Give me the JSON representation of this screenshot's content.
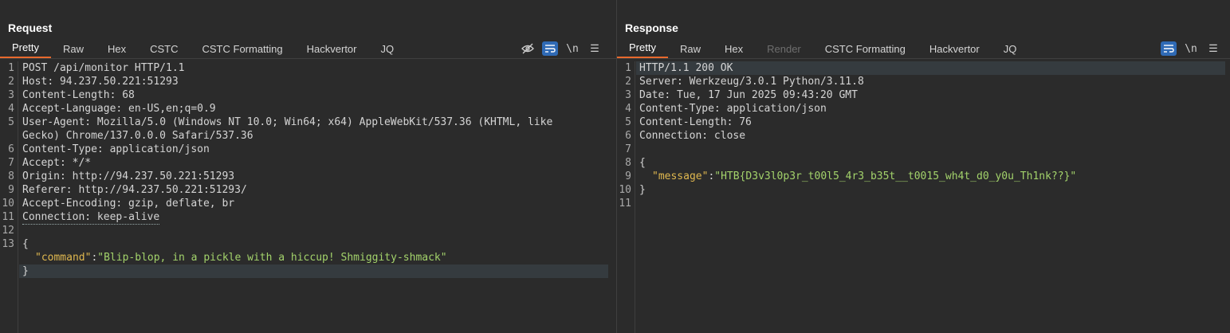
{
  "request": {
    "title": "Request",
    "tabs": [
      "Pretty",
      "Raw",
      "Hex",
      "CSTC",
      "CSTC Formatting",
      "Hackvertor",
      "JQ"
    ],
    "tools": {
      "hide": "⊘",
      "wrap": "≡",
      "newline": "\\n",
      "menu": "☰"
    },
    "lines": {
      "l1": {
        "num": "1",
        "text": "POST /api/monitor HTTP/1.1"
      },
      "l2": {
        "num": "2",
        "key": "Host",
        "val": " 94.237.50.221:51293"
      },
      "l3": {
        "num": "3",
        "key": "Content-Length",
        "val": " 68"
      },
      "l4": {
        "num": "4",
        "key": "Accept-Language",
        "val": " en-US,en;q=0.9"
      },
      "l5": {
        "num": "5",
        "key": "User-Agent",
        "val": " Mozilla/5.0 (Windows NT 10.0; Win64; x64) AppleWebKit/537.36 (KHTML, like Gecko) Chrome/137.0.0.0 Safari/537.36"
      },
      "l6": {
        "num": "6",
        "key": "Content-Type",
        "val": " application/json"
      },
      "l7": {
        "num": "7",
        "key": "Accept",
        "val": " */*"
      },
      "l8": {
        "num": "8",
        "key": "Origin",
        "val": " http://94.237.50.221:51293"
      },
      "l9": {
        "num": "9",
        "key": "Referer",
        "val": " http://94.237.50.221:51293/"
      },
      "l10": {
        "num": "10",
        "key": "Accept-Encoding",
        "val": " gzip, deflate, br"
      },
      "l11": {
        "num": "11",
        "key": "Connection",
        "val": " keep-alive"
      },
      "l12": {
        "num": "12"
      },
      "l13": {
        "num": "13",
        "open": "{"
      },
      "body_key": "\"command\"",
      "body_val": "\"Blip-blop, in a pickle with a hiccup! Shmiggity-shmack\"",
      "close": "}"
    }
  },
  "response": {
    "title": "Response",
    "tabs": [
      "Pretty",
      "Raw",
      "Hex",
      "Render",
      "CSTC Formatting",
      "Hackvertor",
      "JQ"
    ],
    "tools": {
      "wrap": "≡",
      "newline": "\\n",
      "menu": "☰"
    },
    "lines": {
      "l1": {
        "num": "1",
        "text": "HTTP/1.1 200 OK"
      },
      "l2": {
        "num": "2",
        "key": "Server",
        "val": " Werkzeug/3.0.1 Python/3.11.8"
      },
      "l3": {
        "num": "3",
        "key": "Date",
        "val": " Tue, 17 Jun 2025 09:43:20 GMT"
      },
      "l4": {
        "num": "4",
        "key": "Content-Type",
        "val": " application/json"
      },
      "l5": {
        "num": "5",
        "key": "Content-Length",
        "val": " 76"
      },
      "l6": {
        "num": "6",
        "key": "Connection",
        "val": " close"
      },
      "l7": {
        "num": "7"
      },
      "l8": {
        "num": "8",
        "open": "{"
      },
      "l9": {
        "num": "9",
        "jkey": "\"message\"",
        "jval": "\"HTB{D3v3l0p3r_t00l5_4r3_b35t__t0015_wh4t_d0_y0u_Th1nk??}\""
      },
      "l10": {
        "num": "10",
        "close": "}"
      },
      "l11": {
        "num": "11"
      }
    }
  },
  "colors": {
    "accent_tab": "#e8692d",
    "button_blue": "#2f6ab5",
    "json_key": "#e0b84f",
    "json_string": "#a3d36b"
  }
}
